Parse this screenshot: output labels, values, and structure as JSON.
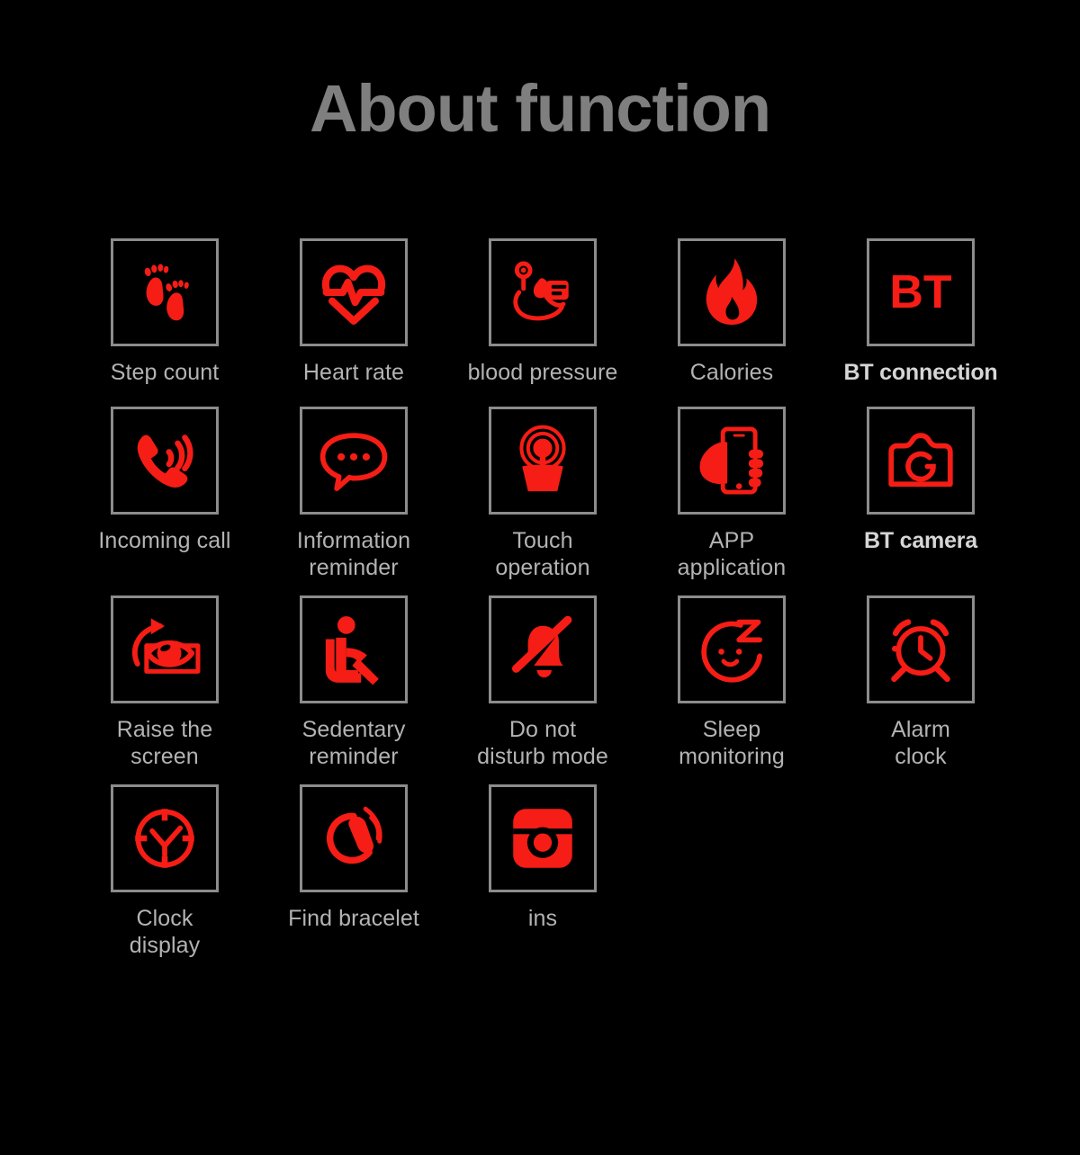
{
  "header": {
    "title": "About function"
  },
  "colors": {
    "background": "#000000",
    "icon_red": "#f51d15",
    "box_border": "#8c8c8c",
    "label_gray": "#b3b3b3",
    "title_gray": "#7f7f7f"
  },
  "grid": {
    "rows": [
      {
        "cells": [
          {
            "icon": "footprints-icon",
            "label": "Step count",
            "bold": false
          },
          {
            "icon": "heart-rate-icon",
            "label": "Heart rate",
            "bold": false
          },
          {
            "icon": "blood-pressure-icon",
            "label": "blood pressure",
            "bold": false
          },
          {
            "icon": "flame-icon",
            "label": "Calories",
            "bold": false
          },
          {
            "icon": "bluetooth-bt-icon",
            "label": "BT connection",
            "bold": true,
            "icon_text": "BT"
          }
        ]
      },
      {
        "cells": [
          {
            "icon": "incoming-call-icon",
            "label": "Incoming call",
            "bold": false
          },
          {
            "icon": "speech-bubble-icon",
            "label": "Information\nreminder",
            "bold": false
          },
          {
            "icon": "touch-operation-icon",
            "label": "Touch\noperation",
            "bold": false
          },
          {
            "icon": "phone-in-hand-icon",
            "label": "APP\napplication",
            "bold": false
          },
          {
            "icon": "camera-icon",
            "label": "BT camera",
            "bold": true
          }
        ]
      },
      {
        "cells": [
          {
            "icon": "raise-screen-eye-icon",
            "label": "Raise the\nscreen",
            "bold": false
          },
          {
            "icon": "seated-person-icon",
            "label": "Sedentary\nreminder",
            "bold": false
          },
          {
            "icon": "bell-muted-icon",
            "label": "Do not\ndisturb mode",
            "bold": false
          },
          {
            "icon": "sleep-face-icon",
            "label": "Sleep\nmonitoring",
            "bold": false
          },
          {
            "icon": "alarm-clock-icon",
            "label": "Alarm\nclock",
            "bold": false
          }
        ]
      },
      {
        "cells": [
          {
            "icon": "clock-display-icon",
            "label": "Clock\ndisplay",
            "bold": false
          },
          {
            "icon": "find-bracelet-icon",
            "label": "Find bracelet",
            "bold": false
          },
          {
            "icon": "instagram-camera-icon",
            "label": "ins",
            "bold": false
          }
        ]
      }
    ]
  }
}
